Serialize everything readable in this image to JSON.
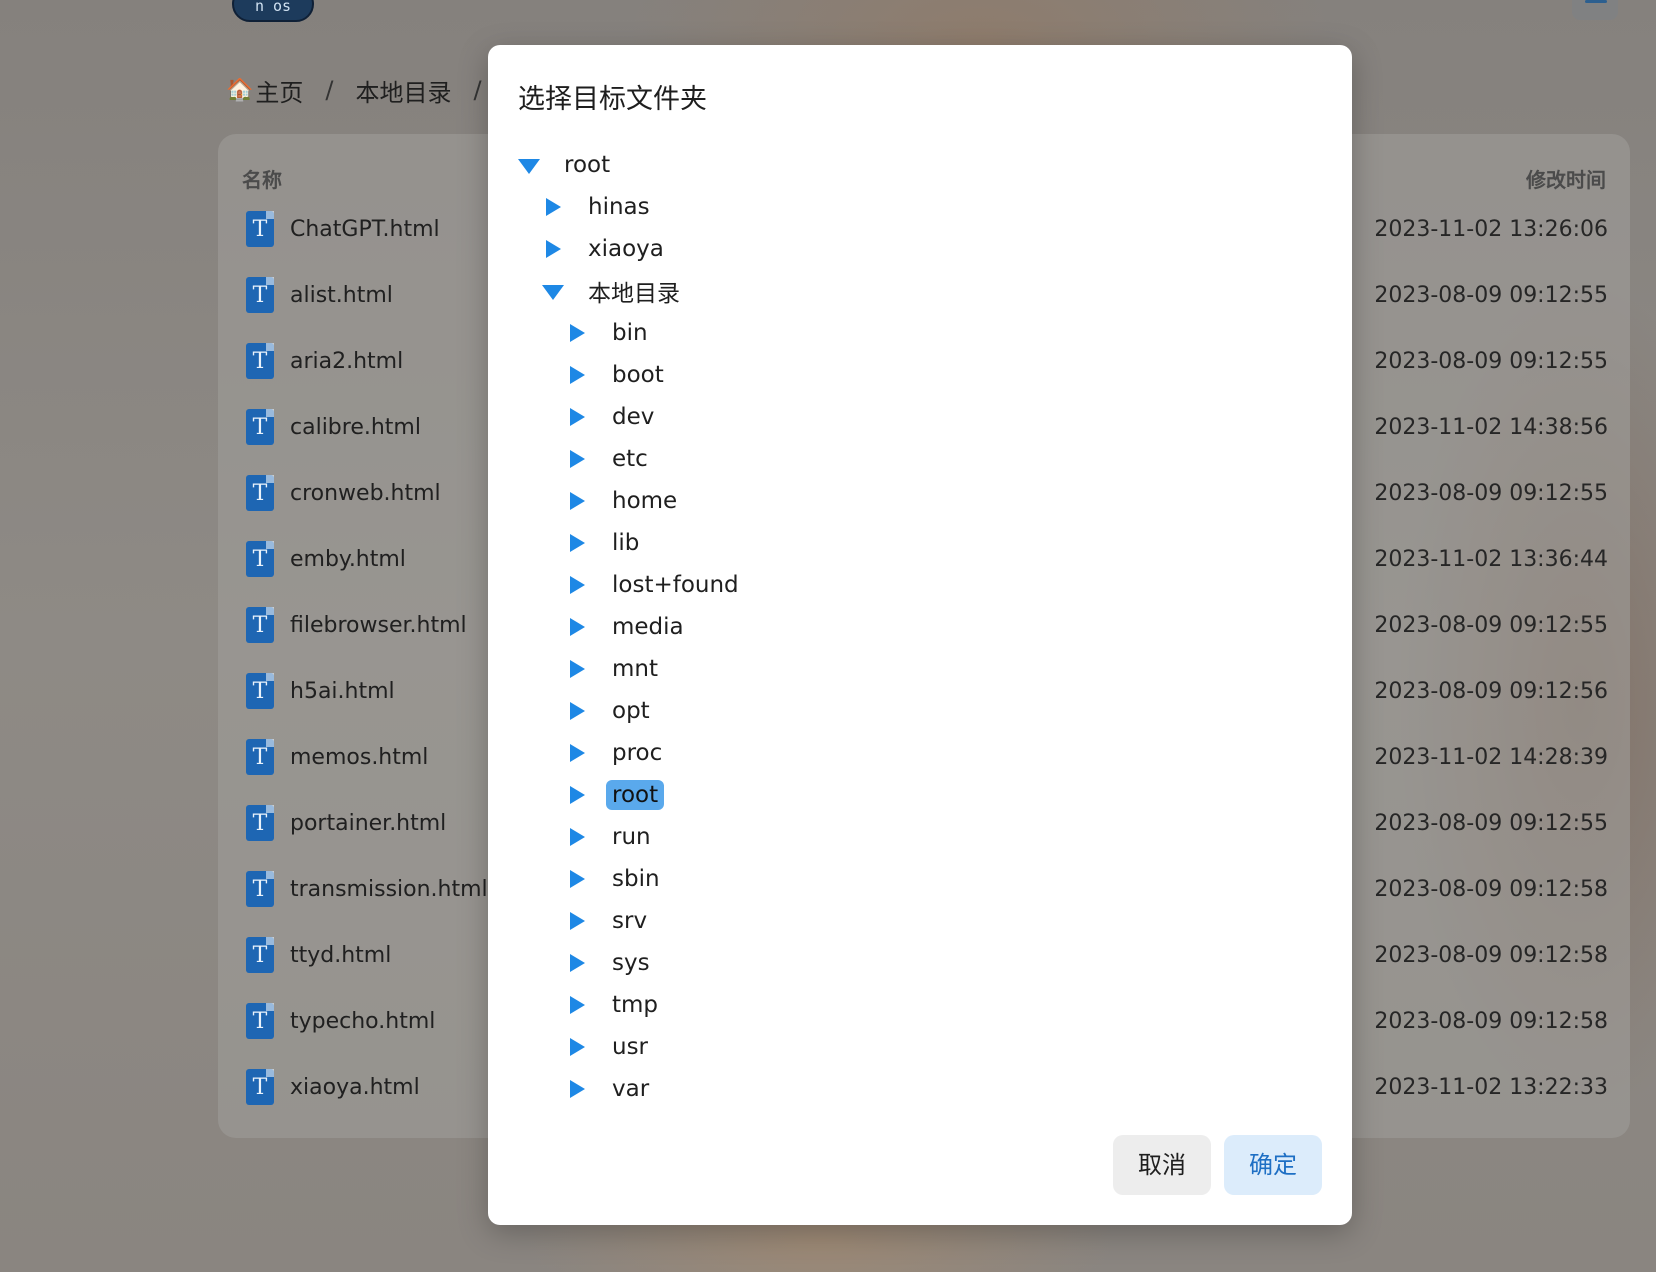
{
  "background": {
    "logo_text": "n os",
    "breadcrumb": {
      "home": "主页",
      "items": [
        "本地目录"
      ],
      "separator": "/"
    },
    "table": {
      "col_name": "名称",
      "col_mtime": "修改时间",
      "rows": [
        {
          "name": "ChatGPT.html",
          "mtime": "2023-11-02 13:26:06"
        },
        {
          "name": "alist.html",
          "mtime": "2023-08-09 09:12:55"
        },
        {
          "name": "aria2.html",
          "mtime": "2023-08-09 09:12:55"
        },
        {
          "name": "calibre.html",
          "mtime": "2023-11-02 14:38:56"
        },
        {
          "name": "cronweb.html",
          "mtime": "2023-08-09 09:12:55"
        },
        {
          "name": "emby.html",
          "mtime": "2023-11-02 13:36:44"
        },
        {
          "name": "filebrowser.html",
          "mtime": "2023-08-09 09:12:55"
        },
        {
          "name": "h5ai.html",
          "mtime": "2023-08-09 09:12:56"
        },
        {
          "name": "memos.html",
          "mtime": "2023-11-02 14:28:39"
        },
        {
          "name": "portainer.html",
          "mtime": "2023-08-09 09:12:55"
        },
        {
          "name": "transmission.html",
          "mtime": "2023-08-09 09:12:58"
        },
        {
          "name": "ttyd.html",
          "mtime": "2023-08-09 09:12:58"
        },
        {
          "name": "typecho.html",
          "mtime": "2023-08-09 09:12:58"
        },
        {
          "name": "xiaoya.html",
          "mtime": "2023-11-02 13:22:33"
        }
      ],
      "file_icon_glyph": "T"
    }
  },
  "dialog": {
    "title": "选择目标文件夹",
    "tree": [
      {
        "label": "root",
        "level": 0,
        "state": "expanded",
        "selected": false
      },
      {
        "label": "hinas",
        "level": 1,
        "state": "collapsed",
        "selected": false
      },
      {
        "label": "xiaoya",
        "level": 1,
        "state": "collapsed",
        "selected": false
      },
      {
        "label": "本地目录",
        "level": 1,
        "state": "expanded",
        "selected": false
      },
      {
        "label": "bin",
        "level": 2,
        "state": "collapsed",
        "selected": false
      },
      {
        "label": "boot",
        "level": 2,
        "state": "collapsed",
        "selected": false
      },
      {
        "label": "dev",
        "level": 2,
        "state": "collapsed",
        "selected": false
      },
      {
        "label": "etc",
        "level": 2,
        "state": "collapsed",
        "selected": false
      },
      {
        "label": "home",
        "level": 2,
        "state": "collapsed",
        "selected": false
      },
      {
        "label": "lib",
        "level": 2,
        "state": "collapsed",
        "selected": false
      },
      {
        "label": "lost+found",
        "level": 2,
        "state": "collapsed",
        "selected": false
      },
      {
        "label": "media",
        "level": 2,
        "state": "collapsed",
        "selected": false
      },
      {
        "label": "mnt",
        "level": 2,
        "state": "collapsed",
        "selected": false
      },
      {
        "label": "opt",
        "level": 2,
        "state": "collapsed",
        "selected": false
      },
      {
        "label": "proc",
        "level": 2,
        "state": "collapsed",
        "selected": false
      },
      {
        "label": "root",
        "level": 2,
        "state": "collapsed",
        "selected": true
      },
      {
        "label": "run",
        "level": 2,
        "state": "collapsed",
        "selected": false
      },
      {
        "label": "sbin",
        "level": 2,
        "state": "collapsed",
        "selected": false
      },
      {
        "label": "srv",
        "level": 2,
        "state": "collapsed",
        "selected": false
      },
      {
        "label": "sys",
        "level": 2,
        "state": "collapsed",
        "selected": false
      },
      {
        "label": "tmp",
        "level": 2,
        "state": "collapsed",
        "selected": false
      },
      {
        "label": "usr",
        "level": 2,
        "state": "collapsed",
        "selected": false
      },
      {
        "label": "var",
        "level": 2,
        "state": "collapsed",
        "selected": false
      }
    ],
    "cancel_label": "取消",
    "ok_label": "确定"
  },
  "colors": {
    "accent": "#1e88e5",
    "selected_bg": "#5aa9ec",
    "ok_bg": "#dcecfb",
    "ok_text": "#1e6fc4"
  },
  "icons": {
    "home": "house-icon",
    "file": "text-file-icon",
    "tree_collapsed": "caret-right-icon",
    "tree_expanded": "caret-down-icon",
    "menu": "list-icon"
  }
}
